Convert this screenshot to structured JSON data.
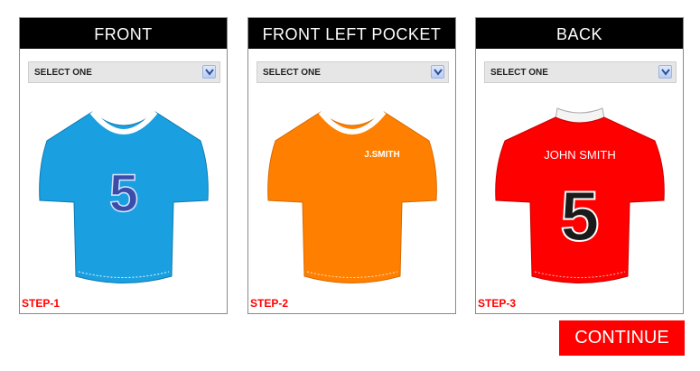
{
  "panels": [
    {
      "title": "FRONT",
      "select_value": "SELECT ONE",
      "step_label": "STEP-1",
      "shirt_color": "#1aa0e0",
      "shirt_number": "5",
      "shirt_text": ""
    },
    {
      "title": "FRONT LEFT POCKET",
      "select_value": "SELECT ONE",
      "step_label": "STEP-2",
      "shirt_color": "#ff8000",
      "shirt_number": "",
      "shirt_text": "J.SMITH"
    },
    {
      "title": "BACK",
      "select_value": "SELECT ONE",
      "step_label": "STEP-3",
      "shirt_color": "#ff0000",
      "shirt_number": "5",
      "shirt_text": "JOHN SMITH"
    }
  ],
  "continue_label": "CONTINUE",
  "icons": {
    "select_arrow": "chevron-down-icon"
  }
}
